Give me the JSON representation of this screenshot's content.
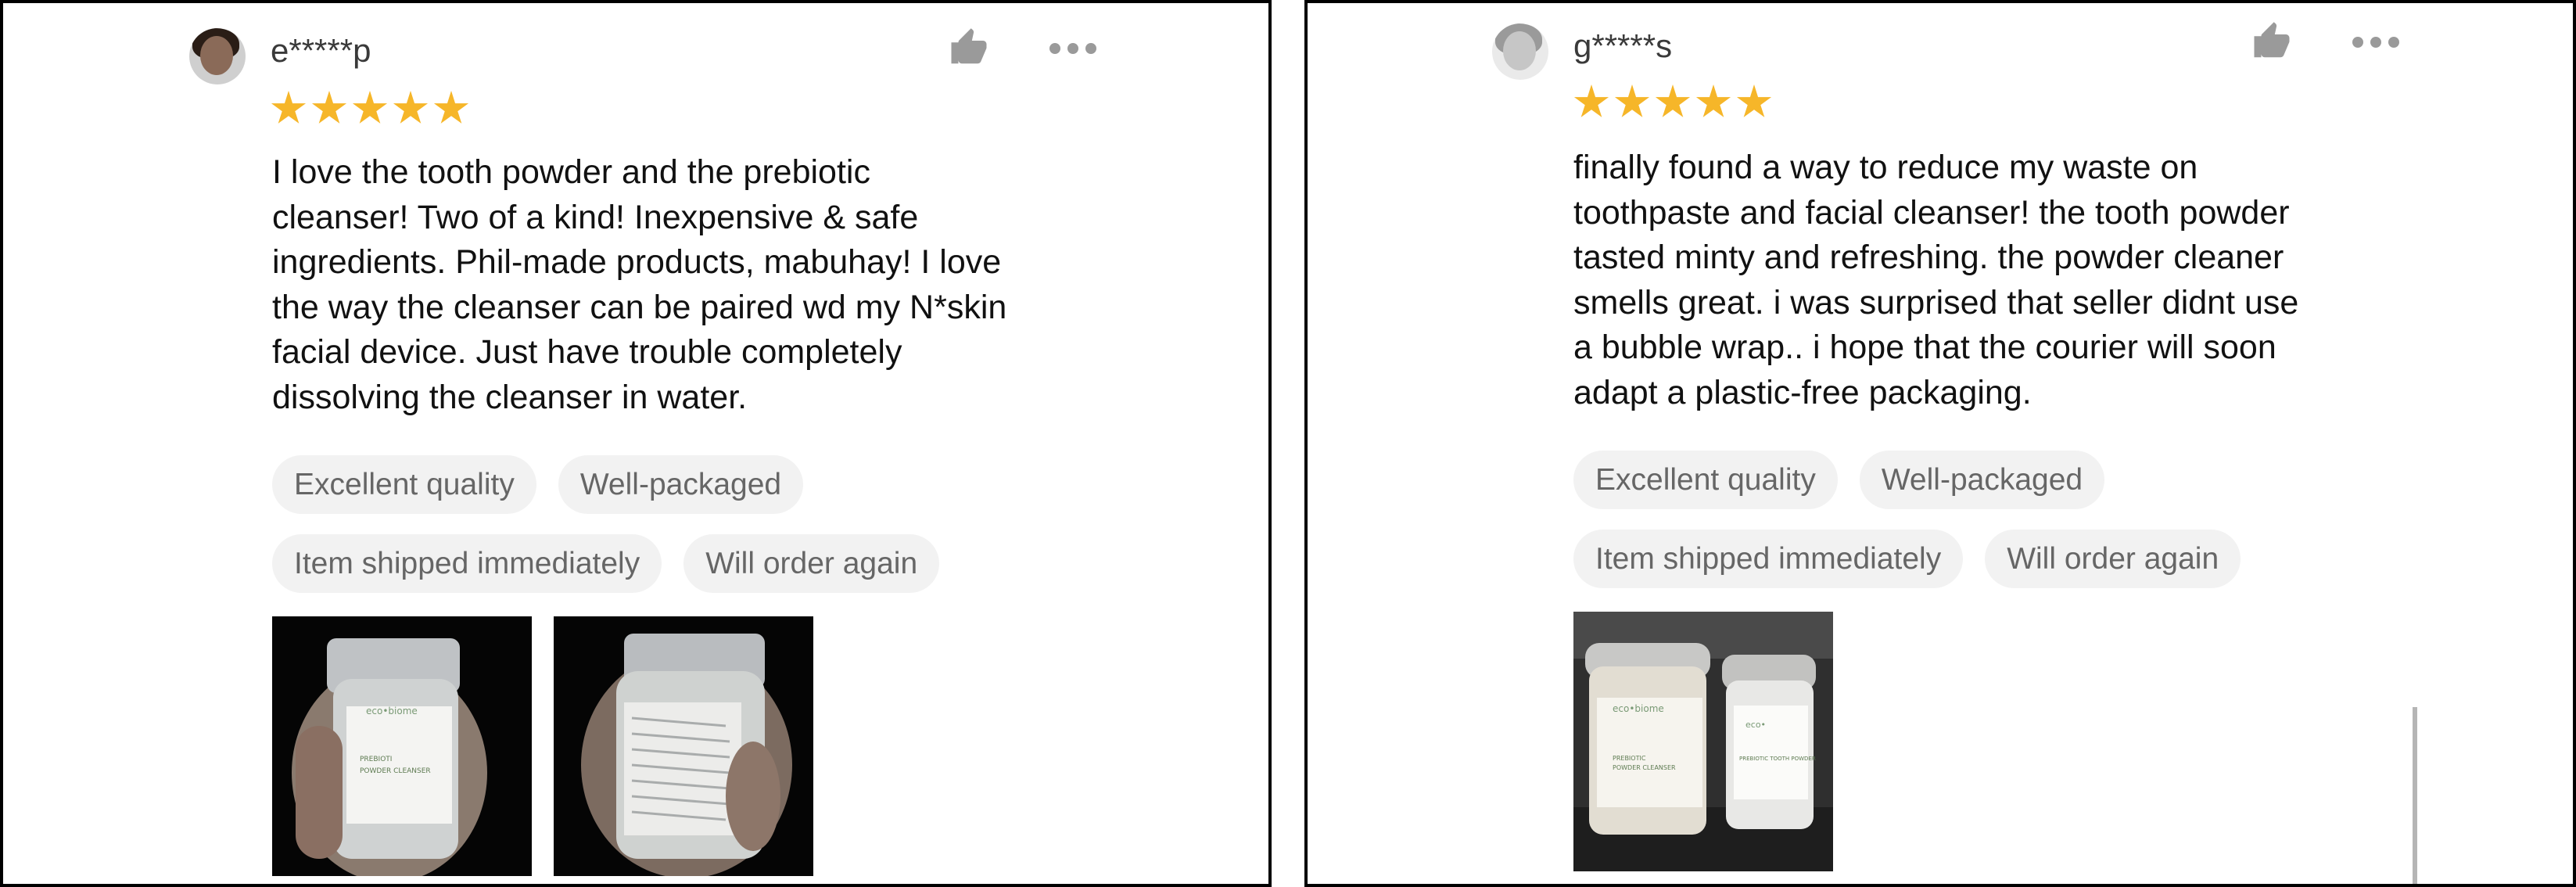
{
  "reviews": [
    {
      "username": "e*****p",
      "rating": 5,
      "text": "I love the tooth powder and the prebiotic\ncleanser! Two of a kind! Inexpensive & safe\ningredients. Phil-made products, mabuhay! I love\nthe way the cleanser can be paired wd my N*skin\nfacial device. Just have trouble completely\ndissolving the cleanser in water.",
      "tags": [
        "Excellent quality",
        "Well-packaged",
        "Item shipped immediately",
        "Will order again"
      ],
      "photos": [
        {
          "brand": "eco•biome",
          "label": "PREBIOTIC\nPOWDER CLEANSER"
        },
        {
          "brand": "",
          "label": ""
        }
      ]
    },
    {
      "username": "g*****s",
      "rating": 5,
      "text": "finally found a way to reduce my waste on\ntoothpaste and facial cleanser! the tooth powder\ntasted minty and refreshing. the powder cleaner\nsmells great. i was surprised that seller didnt use\na bubble wrap.. i hope that the courier will soon\nadapt a plastic-free packaging.",
      "tags": [
        "Excellent quality",
        "Well-packaged",
        "Item shipped immediately",
        "Will order again"
      ],
      "photos": [
        {
          "brand": "eco•biome",
          "label": "PREBIOTIC\nPOWDER CLEANSER"
        }
      ]
    }
  ],
  "colors": {
    "star": "#f6b629",
    "tag_bg": "#f2f2f2",
    "tag_text": "#666666",
    "icon_grey": "#9a9a9a"
  },
  "icons": {
    "like": "thumbs-up-icon",
    "more": "more-horizontal-icon",
    "star": "star-icon"
  }
}
